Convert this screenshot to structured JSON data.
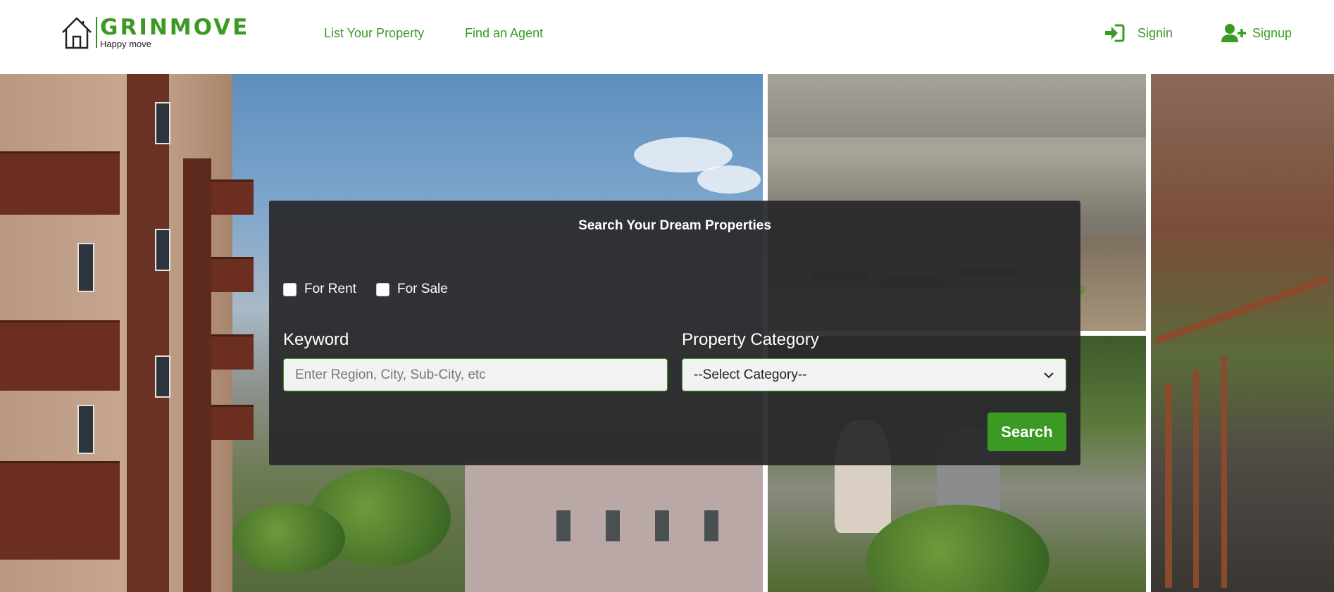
{
  "brand": {
    "name": "GRINMOVE",
    "tagline": "Happy move",
    "accent_color": "#3a9a23"
  },
  "nav": {
    "list_property": "List Your Property",
    "find_agent": "Find an Agent"
  },
  "auth": {
    "signin": {
      "label": "Signin",
      "icon": "signin-arrow-icon"
    },
    "signup": {
      "label": "Signup",
      "icon": "user-plus-icon"
    }
  },
  "search": {
    "title": "Search Your Dream Properties",
    "options": {
      "rent": "For Rent",
      "sale": "For Sale"
    },
    "keyword": {
      "label": "Keyword",
      "placeholder": "Enter Region, City, Sub-City, etc"
    },
    "category": {
      "label": "Property Category",
      "selected": "--Select Category--"
    },
    "button": "Search"
  }
}
